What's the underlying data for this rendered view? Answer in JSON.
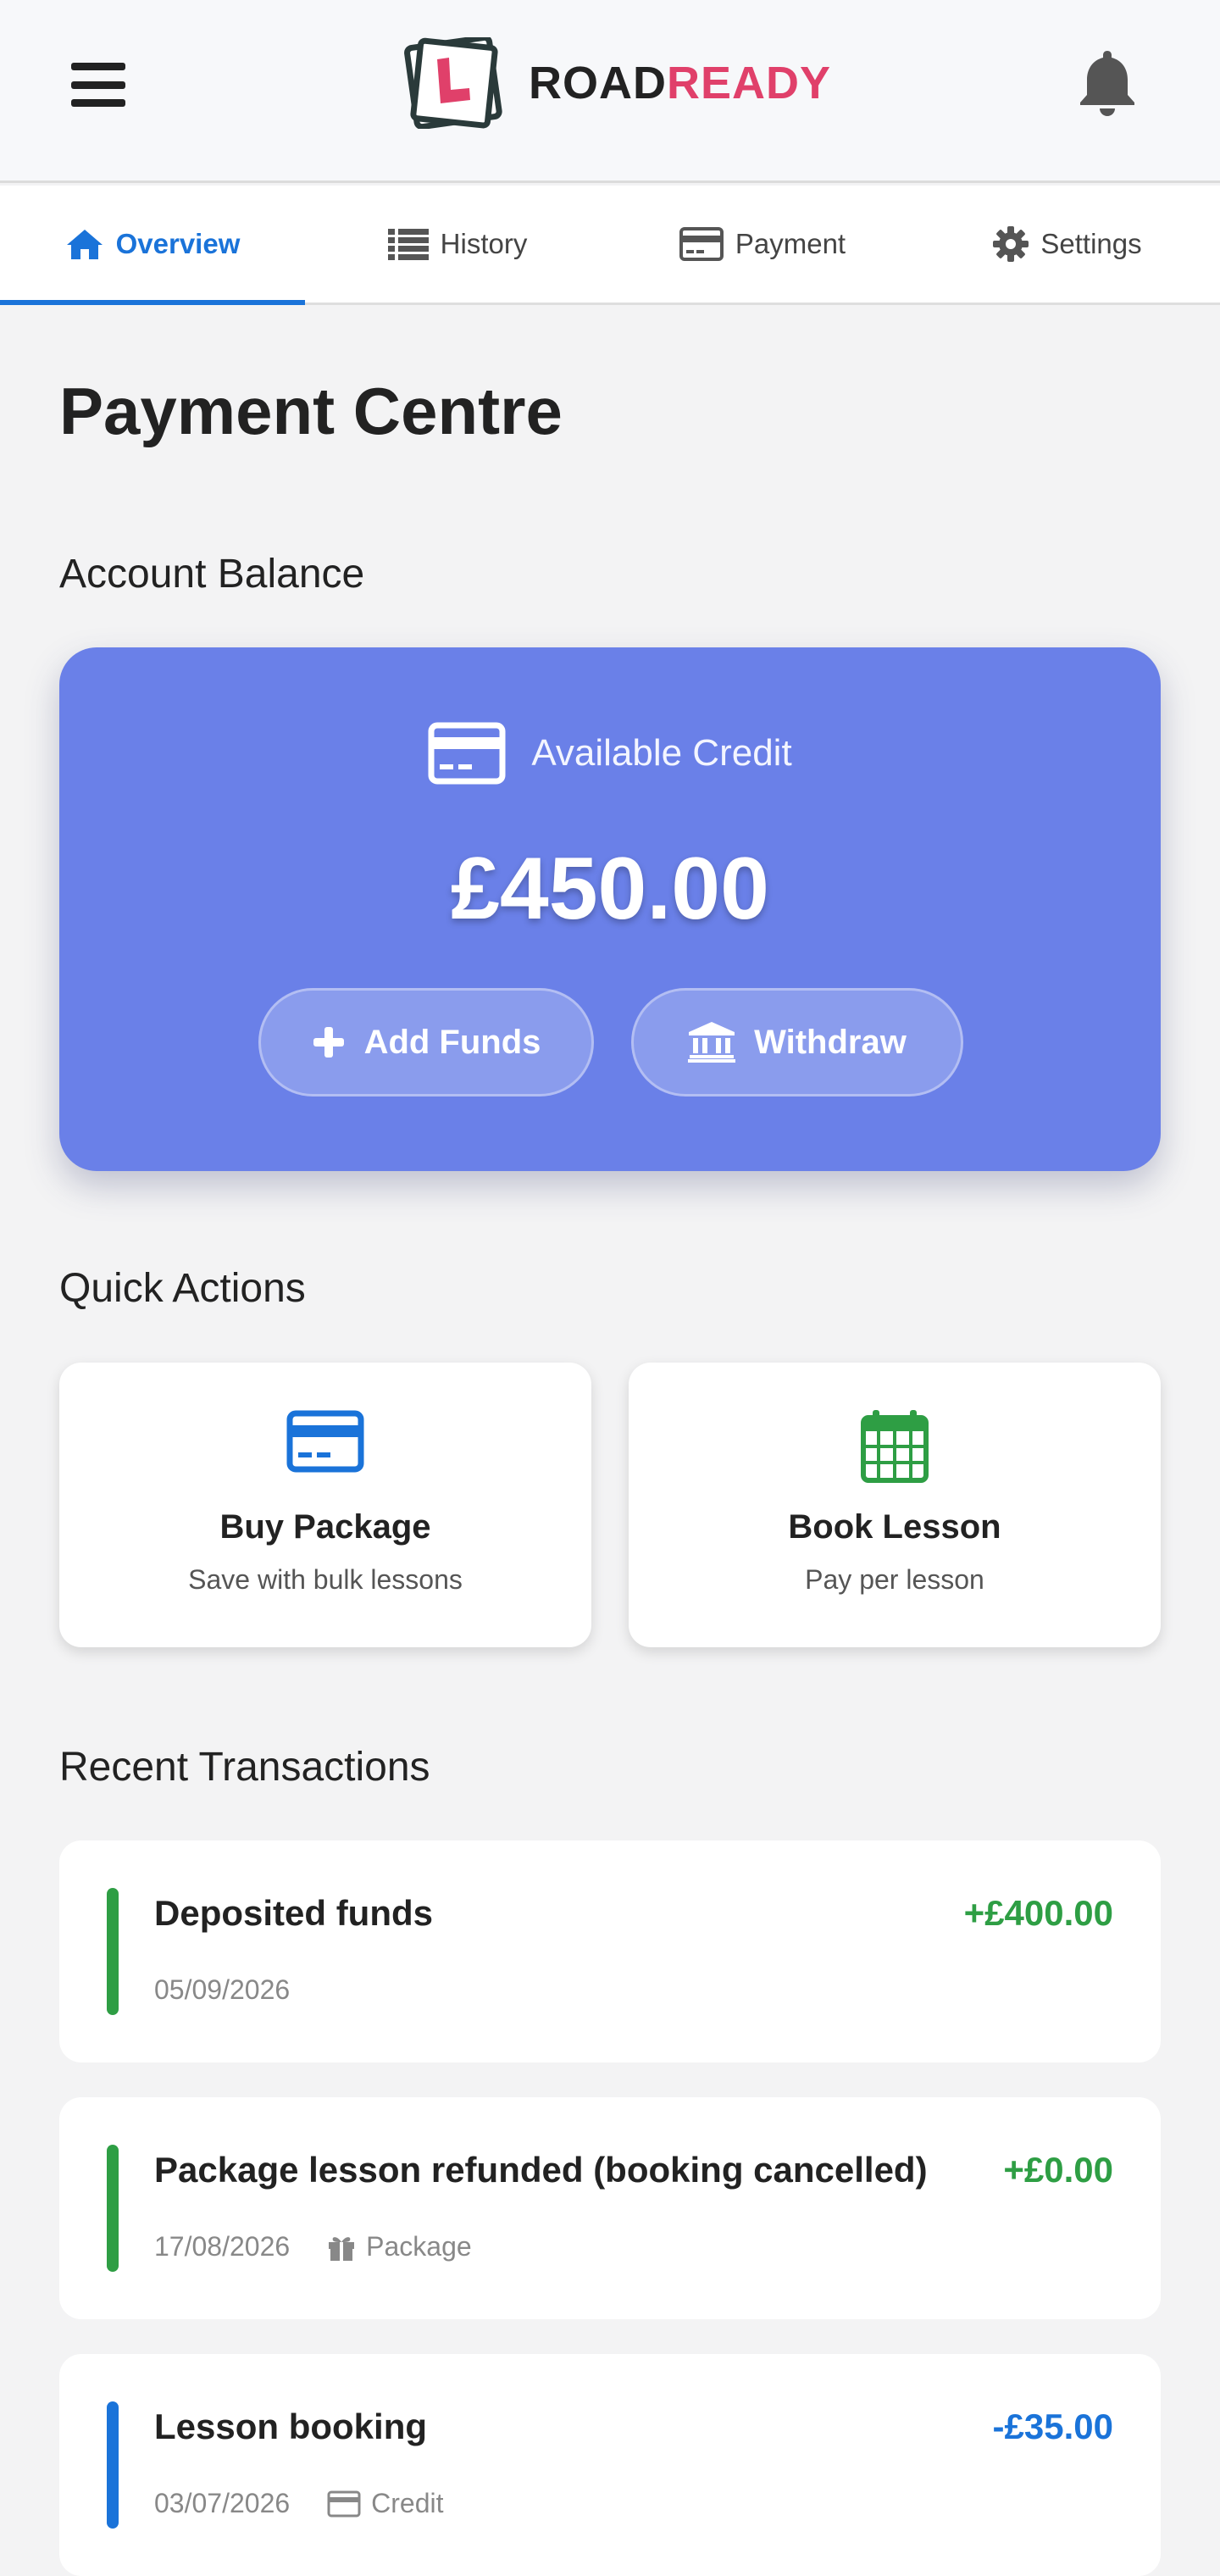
{
  "header": {
    "brand_road": "ROAD",
    "brand_ready": "READY"
  },
  "tabs": [
    {
      "label": "Overview",
      "icon": "home-icon",
      "active": true
    },
    {
      "label": "History",
      "icon": "list-icon",
      "active": false
    },
    {
      "label": "Payment",
      "icon": "credit-card-icon",
      "active": false
    },
    {
      "label": "Settings",
      "icon": "gear-icon",
      "active": false
    }
  ],
  "page": {
    "title": "Payment Centre"
  },
  "balance": {
    "section_title": "Account Balance",
    "label": "Available Credit",
    "amount": "£450.00",
    "add_funds": "Add Funds",
    "withdraw": "Withdraw"
  },
  "quick_actions": {
    "section_title": "Quick Actions",
    "items": [
      {
        "title": "Buy Package",
        "subtitle": "Save with bulk lessons",
        "icon": "credit-card-icon"
      },
      {
        "title": "Book Lesson",
        "subtitle": "Pay per lesson",
        "icon": "calendar-icon"
      }
    ]
  },
  "transactions": {
    "section_title": "Recent Transactions",
    "items": [
      {
        "title": "Deposited funds",
        "amount": "+£400.00",
        "date": "05/09/2026",
        "tag": "",
        "kind": "credit"
      },
      {
        "title": "Package lesson refunded (booking cancelled)",
        "amount": "+£0.00",
        "date": "17/08/2026",
        "tag": "Package",
        "kind": "credit"
      },
      {
        "title": "Lesson booking",
        "amount": "-£35.00",
        "date": "03/07/2026",
        "tag": "Credit",
        "kind": "debit"
      }
    ]
  },
  "colors": {
    "accent": "#1a73d9",
    "brand": "#e0406a",
    "balance_card": "#6a80e8",
    "positive": "#2e9e44"
  }
}
